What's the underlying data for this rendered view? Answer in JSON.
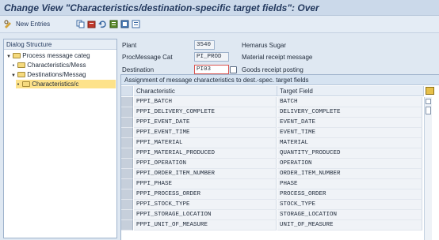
{
  "title": "Change View \"Characteristics/destination-specific target fields\": Over",
  "toolbar": {
    "new_entries_label": "New Entries"
  },
  "dialog_structure": {
    "header": "Dialog Structure",
    "items": [
      {
        "label": "Process message categ"
      },
      {
        "label": "Characteristics/Mess"
      },
      {
        "label": "Destinations/Messag"
      },
      {
        "label": "Characteristics/c"
      }
    ]
  },
  "fields": {
    "plant": {
      "label": "Plant",
      "value": "3540",
      "desc": "Hemarus Sugar"
    },
    "proc_cat": {
      "label": "ProcMessage Cat",
      "value": "PI_PROD",
      "desc": "Material receipt message"
    },
    "destination": {
      "label": "Destination",
      "value": "PI03",
      "desc": "Goods receipt posting"
    }
  },
  "table": {
    "caption": "Assignment of message characteristics to dest.-spec. target fields",
    "columns": [
      "Characteristic",
      "Target Field"
    ],
    "rows": [
      [
        "PPPI_BATCH",
        "BATCH"
      ],
      [
        "PPPI_DELIVERY_COMPLETE",
        "DELIVERY_COMPLETE"
      ],
      [
        "PPPI_EVENT_DATE",
        "EVENT_DATE"
      ],
      [
        "PPPI_EVENT_TIME",
        "EVENT_TIME"
      ],
      [
        "PPPI_MATERIAL",
        "MATERIAL"
      ],
      [
        "PPPI_MATERIAL_PRODUCED",
        "QUANTITY_PRODUCED"
      ],
      [
        "PPPI_OPERATION",
        "OPERATION"
      ],
      [
        "PPPI_ORDER_ITEM_NUMBER",
        "ORDER_ITEM_NUMBER"
      ],
      [
        "PPPI_PHASE",
        "PHASE"
      ],
      [
        "PPPI_PROCESS_ORDER",
        "PROCESS_ORDER"
      ],
      [
        "PPPI_STOCK_TYPE",
        "STOCK_TYPE"
      ],
      [
        "PPPI_STORAGE_LOCATION",
        "STORAGE_LOCATION"
      ],
      [
        "PPPI_UNIT_OF_MEASURE",
        "UNIT_OF_MEASURE"
      ]
    ]
  },
  "icons": [
    "pencil-glasses-icon",
    "copy-icon",
    "delete-icon",
    "undo-icon",
    "select-all-icon",
    "select-block-icon",
    "deselect-all-icon",
    "table-settings-icon"
  ]
}
